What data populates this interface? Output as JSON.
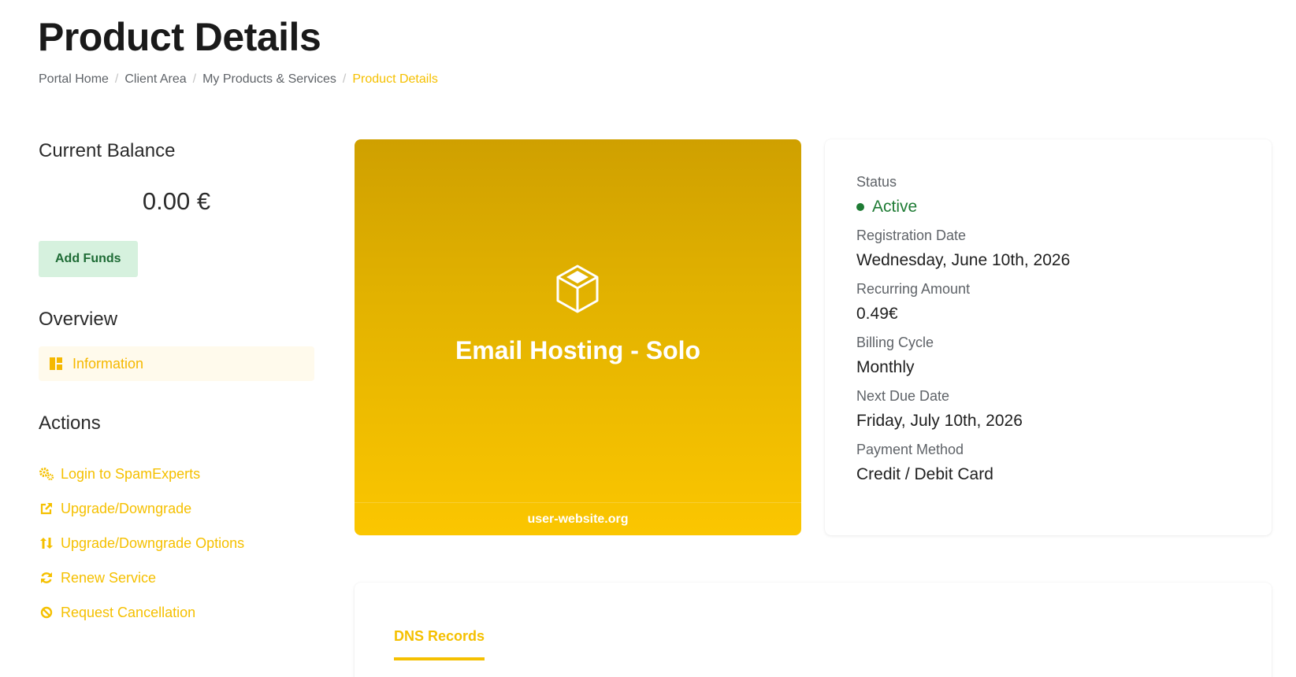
{
  "page": {
    "title": "Product Details"
  },
  "breadcrumb": {
    "items": [
      "Portal Home",
      "Client Area",
      "My Products & Services",
      "Product Details"
    ],
    "separator": "/"
  },
  "sidebar": {
    "balance_heading": "Current Balance",
    "balance_value": "0.00 €",
    "add_funds_label": "Add Funds",
    "overview_heading": "Overview",
    "overview_items": [
      {
        "label": "Information",
        "icon": "dashboard-icon"
      }
    ],
    "actions_heading": "Actions",
    "actions": [
      {
        "label": "Login to SpamExperts",
        "icon": "cogs-icon"
      },
      {
        "label": "Upgrade/Downgrade",
        "icon": "external-link-icon"
      },
      {
        "label": "Upgrade/Downgrade Options",
        "icon": "sort-arrows-icon"
      },
      {
        "label": "Renew Service",
        "icon": "sync-icon"
      },
      {
        "label": "Request Cancellation",
        "icon": "ban-icon"
      }
    ]
  },
  "product": {
    "icon": "cube-icon",
    "name": "Email Hosting - Solo",
    "domain": "user-website.org"
  },
  "info": {
    "status_label": "Status",
    "status_value": "Active",
    "registration_label": "Registration Date",
    "registration_value": "Wednesday, June 10th, 2026",
    "recurring_label": "Recurring Amount",
    "recurring_value": "0.49€",
    "billing_label": "Billing Cycle",
    "billing_value": "Monthly",
    "next_due_label": "Next Due Date",
    "next_due_value": "Friday, July 10th, 2026",
    "payment_label": "Payment Method",
    "payment_value": "Credit / Debit Card"
  },
  "tabs": {
    "dns_label": "DNS Records"
  },
  "colors": {
    "accent": "#f5c000",
    "status_active": "#1e7b34",
    "add_funds_bg": "#d6f1de",
    "add_funds_text": "#1e6b35"
  }
}
